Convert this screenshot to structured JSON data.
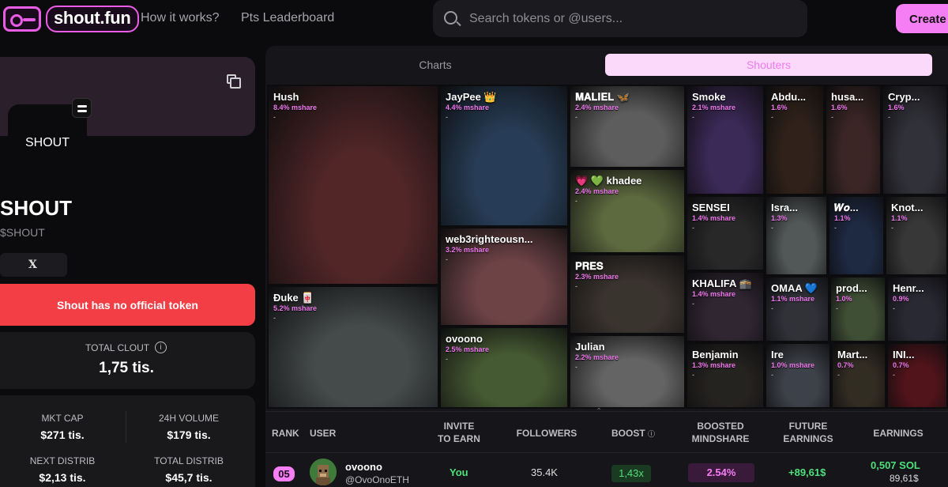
{
  "header": {
    "brand": "shout.fun",
    "nav": [
      "How it works?",
      "Pts Leaderboard"
    ],
    "search_placeholder": "Search tokens or @users...",
    "create_label": "Create C"
  },
  "token": {
    "avatar_label": "SHOUT",
    "name": "SHOUT",
    "ticker": "$SHOUT",
    "x_label": "X",
    "notice": "Shout has no official token",
    "total_clout_label": "TOTAL CLOUT",
    "total_clout_value": "1,75 tis.",
    "stats": [
      {
        "label": "MKT CAP",
        "value": "$271 tis."
      },
      {
        "label": "24H VOLUME",
        "value": "$179 tis."
      },
      {
        "label": "NEXT DISTRIB",
        "value": "$2,13 tis."
      },
      {
        "label": "TOTAL DISTRIB",
        "value": "$45,7 tis."
      }
    ]
  },
  "tabs": {
    "charts": "Charts",
    "shouters": "Shouters"
  },
  "treemap": [
    {
      "name": "Hush",
      "share": "8.4% mshare",
      "dash": "-",
      "color": "#7e3b3d"
    },
    {
      "name": "Đuke 🀄",
      "share": "5.2% mshare",
      "dash": "-",
      "color": "#6b7374"
    },
    {
      "name": "JayPee 👑",
      "share": "4.4% mshare",
      "dash": "-",
      "color": "#3d5f86"
    },
    {
      "name": "web3righteousn...",
      "share": "3.2% mshare",
      "dash": "-",
      "color": "#a8676b"
    },
    {
      "name": "ovoono",
      "share": "2.5% mshare",
      "dash": "-",
      "color": "#6a8a4e"
    },
    {
      "name": "𝐌𝐀𝐋𝐈𝐄𝐋 🦋",
      "share": "2.4% mshare",
      "dash": "-",
      "color": "#8f8f8f"
    },
    {
      "name": "💗 💚 khadee",
      "share": "2.4% mshare",
      "dash": "-",
      "color": "#8fa160"
    },
    {
      "name": "𝐏𝐑𝐄𝐒",
      "share": "2.3% mshare",
      "dash": "-",
      "color": "#5a5048"
    },
    {
      "name": "Julian",
      "share": "2.2% mshare",
      "dash": "-",
      "color": "#9a9a9a"
    },
    {
      "name": "Smoke",
      "share": "2.1% mshare",
      "dash": "-",
      "color": "#5b3f86"
    },
    {
      "name": "Abdu...",
      "share": "1.6%",
      "dash": "-",
      "color": "#4a3428"
    },
    {
      "name": "husa...",
      "share": "1.6%",
      "dash": "-",
      "color": "#5b3a3a"
    },
    {
      "name": "Cryp...",
      "share": "1.6%",
      "dash": "-",
      "color": "#4c4c58"
    },
    {
      "name": "SENSEI",
      "share": "1.4% mshare",
      "dash": "-",
      "color": "#3e3e40"
    },
    {
      "name": "Isra...",
      "share": "1.3%",
      "dash": "-",
      "color": "#7f8686"
    },
    {
      "name": "𝑾𝒐...",
      "share": "1.1%",
      "dash": "-",
      "color": "#2e3f66"
    },
    {
      "name": "Knot...",
      "share": "1.1%",
      "dash": "-",
      "color": "#575555"
    },
    {
      "name": "KHALIFA 🕋",
      "share": "1.4% mshare",
      "dash": "-",
      "color": "#4a3b4d"
    },
    {
      "name": "OMAA 💙",
      "share": "1.1% mshare",
      "dash": "-",
      "color": "#4a4d57"
    },
    {
      "name": "prod...",
      "share": "1.0%",
      "dash": "-",
      "color": "#627a52"
    },
    {
      "name": "Henr...",
      "share": "0.9%",
      "dash": "-",
      "color": "#404050"
    },
    {
      "name": "Benjamin",
      "share": "1.3% mshare",
      "dash": "-",
      "color": "#3a3632"
    },
    {
      "name": "Ire",
      "share": "1.0% mshare",
      "dash": "-",
      "color": "#5f6470"
    },
    {
      "name": "Mart...",
      "share": "0.7%",
      "dash": "-",
      "color": "#4e4536"
    },
    {
      "name": "INI...",
      "share": "0.7%",
      "dash": "-",
      "color": "#7b1f28"
    }
  ],
  "table": {
    "headers": {
      "rank": "RANK",
      "user": "USER",
      "invite_1": "INVITE",
      "invite_2": "TO EARN",
      "followers": "FOLLOWERS",
      "boost": "BOOST",
      "boosted_1": "BOOSTED",
      "boosted_2": "MINDSHARE",
      "future_1": "FUTURE",
      "future_2": "EARNINGS",
      "earnings": "EARNINGS"
    },
    "row": {
      "rank": "05",
      "name": "ovoono",
      "handle": "@OvoOnoETH",
      "invite": "You",
      "followers": "35.4K",
      "boost": "1,43x",
      "mindshare": "2.54%",
      "future": "+89,61$",
      "earnings_sol": "0,507 SOL",
      "earnings_usd": "89,61$"
    }
  },
  "colors": {
    "accent": "#f67ef4",
    "danger": "#f23e44",
    "positive": "#4ee07b"
  }
}
